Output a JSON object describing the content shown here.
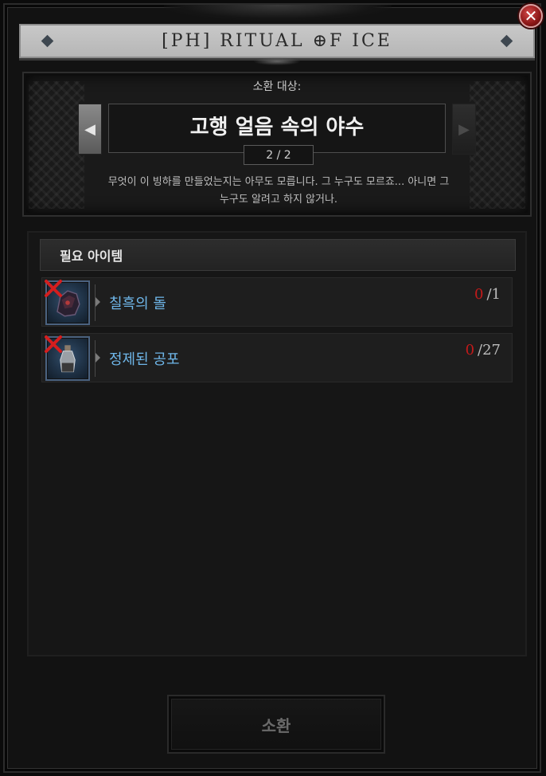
{
  "window": {
    "title": "[PH] RITUAL ⊕F ICE",
    "close_icon": "close-icon"
  },
  "summon": {
    "label": "소환 대상:",
    "target_name": "고행 얼음 속의 야수",
    "page": "2 / 2",
    "description_line1": "무엇이 이 빙하를 만들었는지는 아무도 모릅니다. 그 누구도 모르죠... 아니면 그",
    "description_line2": "누구도 알려고 하지 않거나."
  },
  "required_items": {
    "header": "필요 아이템",
    "items": [
      {
        "name": "칠흑의 돌",
        "have": "0",
        "need": "/1",
        "icon": "dark-stone-icon",
        "status": "missing"
      },
      {
        "name": "정제된 공포",
        "have": "0",
        "need": "/27",
        "icon": "refined-terror-vial-icon",
        "status": "missing"
      }
    ]
  },
  "actions": {
    "summon_button": "소환"
  },
  "colors": {
    "item_name": "#6fb7ea",
    "missing": "#c21a1a",
    "title_bar": "#c0c0c0"
  }
}
